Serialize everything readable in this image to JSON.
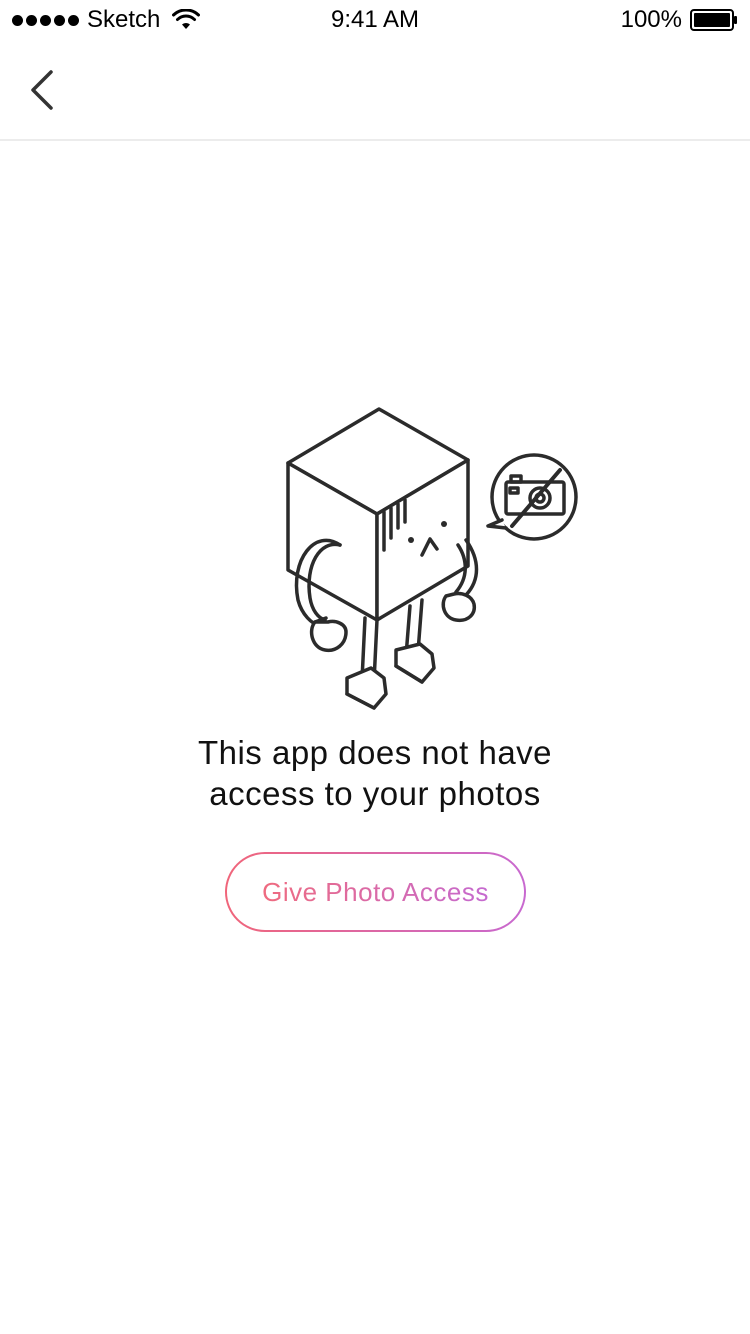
{
  "status_bar": {
    "carrier": "Sketch",
    "time": "9:41 AM",
    "battery": "100%",
    "signal_dots": 5
  },
  "nav": {
    "back_icon": "chevron-left-icon"
  },
  "empty_state": {
    "illustration": "sad-cube-robot-no-camera",
    "message_line1": "This app does not have",
    "message_line2": "access to your photos",
    "button_label": "Give Photo Access"
  },
  "colors": {
    "gradient_start": "#f0657a",
    "gradient_end": "#c869d0",
    "line_art": "#2b2b2b",
    "divider": "#ececec"
  }
}
